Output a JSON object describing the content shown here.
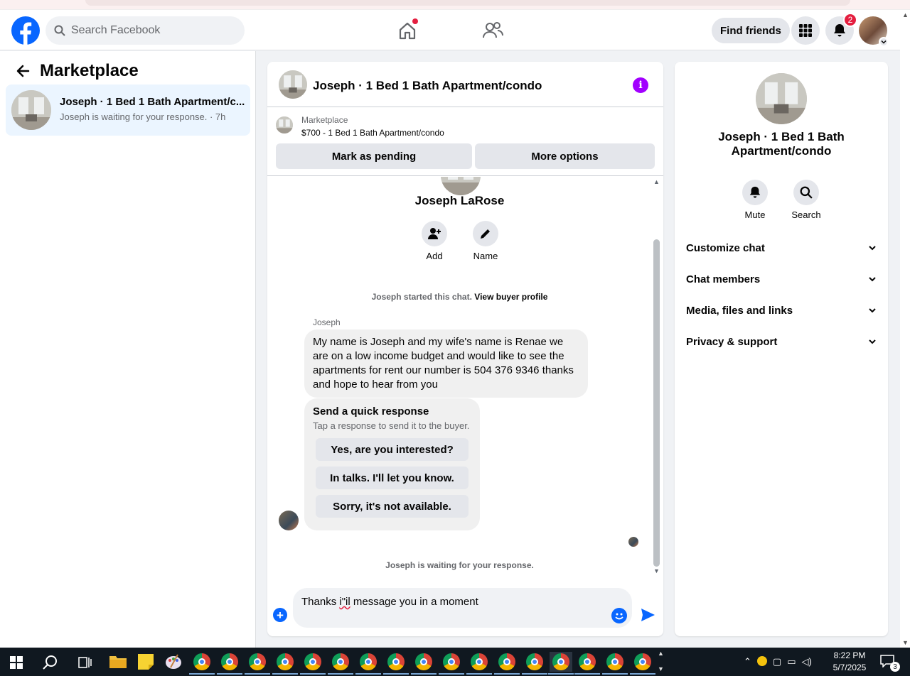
{
  "header": {
    "search_placeholder": "Search Facebook",
    "find_friends": "Find friends",
    "notification_count": "2"
  },
  "sidebar": {
    "title": "Marketplace",
    "conversation": {
      "title": "Joseph · 1 Bed 1 Bath Apartment/c...",
      "subtitle": "Joseph is waiting for your response. · 7h"
    }
  },
  "chat": {
    "title": "Joseph · 1 Bed 1 Bath Apartment/condo",
    "listing_label": "Marketplace",
    "listing_price": "$700 - 1 Bed 1 Bath Apartment/condo",
    "mark_pending": "Mark as pending",
    "more_options": "More options",
    "profile_name": "Joseph LaRose",
    "add_label": "Add",
    "name_label": "Name",
    "started_text": "Joseph started this chat.",
    "view_profile": "View buyer profile",
    "sender_name": "Joseph",
    "message": "My name is Joseph and my wife's name is Renae we are on a low income budget and would like to see the apartments for rent our number is 504 376 9346 thanks and hope to hear from you",
    "quick_title": "Send a quick response",
    "quick_subtitle": "Tap a response to send it to the buyer.",
    "quick_responses": [
      "Yes, are you interested?",
      "In talks. I'll let you know.",
      "Sorry, it's not available."
    ],
    "waiting_text": "Joseph is waiting for your response.",
    "composer_before": "Thanks ",
    "composer_misspelled": "i\"il",
    "composer_after": " message you in a moment"
  },
  "right_panel": {
    "title": "Joseph · 1 Bed 1 Bath Apartment/condo",
    "mute": "Mute",
    "search": "Search",
    "sections": [
      "Customize chat",
      "Chat members",
      "Media, files and links",
      "Privacy & support"
    ]
  },
  "taskbar": {
    "time": "8:22 PM",
    "date": "5/7/2025",
    "notification_count": "3"
  },
  "colors": {
    "brand": "#0866ff",
    "info": "#a200ff",
    "badge": "#e41e3f"
  }
}
